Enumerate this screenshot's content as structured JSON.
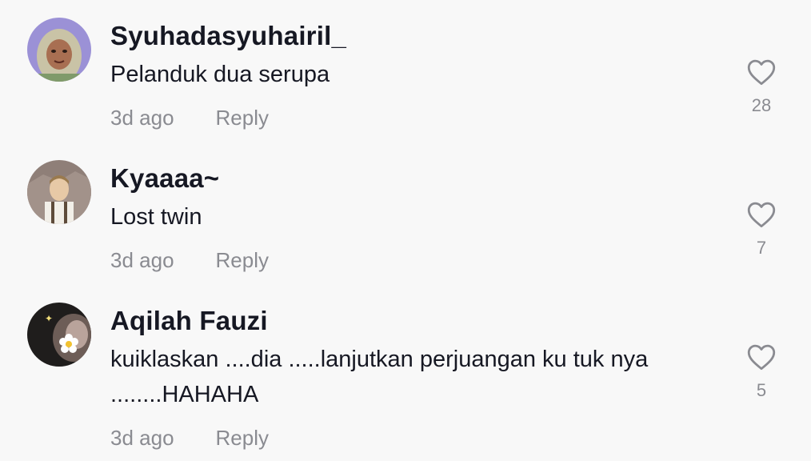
{
  "comments": [
    {
      "username": "Syuhadasyuhairil_",
      "text": "Pelanduk dua serupa",
      "time": "3d ago",
      "reply_label": "Reply",
      "likes": "28",
      "avatar_icon": "avatar-hijab-woman"
    },
    {
      "username": "Kyaaaa~",
      "text": "Lost twin",
      "time": "3d ago",
      "reply_label": "Reply",
      "likes": "7",
      "avatar_icon": "avatar-anime-soldier"
    },
    {
      "username": "Aqilah Fauzi",
      "text": "kuiklaskan ....dia .....lanjutkan perjuangan ku tuk nya ........HAHAHA",
      "time": "3d ago",
      "reply_label": "Reply",
      "likes": "5",
      "avatar_icon": "avatar-flower-girl"
    }
  ],
  "colors": {
    "background": "#f8f8f8",
    "username": "#161823",
    "meta": "#8a8b91",
    "heart_stroke": "#8a8b91"
  }
}
